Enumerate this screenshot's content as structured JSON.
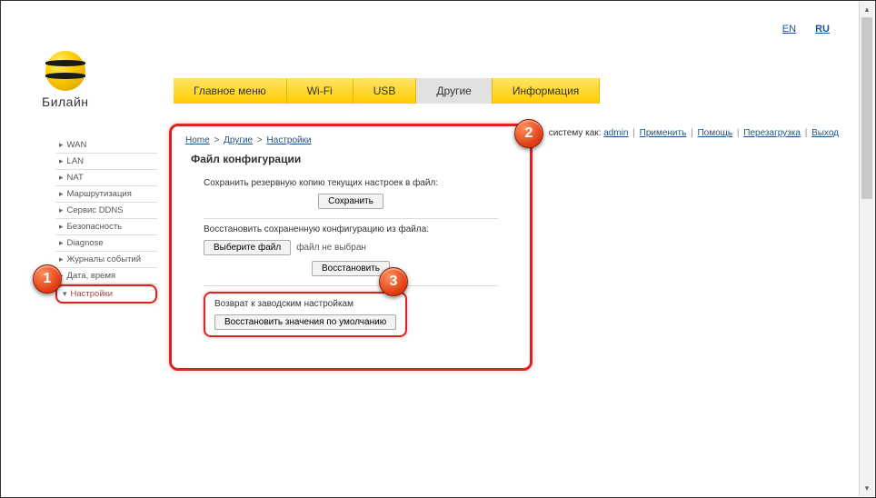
{
  "lang": {
    "en": "EN",
    "ru": "RU"
  },
  "logo_text": "Билайн",
  "nav": {
    "items": [
      {
        "label": "Главное меню"
      },
      {
        "label": "Wi-Fi"
      },
      {
        "label": "USB"
      },
      {
        "label": "Другие"
      },
      {
        "label": "Информация"
      }
    ]
  },
  "status": {
    "prefix": "систему как:",
    "user": "admin",
    "apply": "Применить",
    "help": "Помощь",
    "reboot": "Перезагрузка",
    "logout": "Выход"
  },
  "sidebar": {
    "items": [
      {
        "label": "WAN"
      },
      {
        "label": "LAN"
      },
      {
        "label": "NAT"
      },
      {
        "label": "Маршрутизация"
      },
      {
        "label": "Сервис DDNS"
      },
      {
        "label": "Безопасность"
      },
      {
        "label": "Diagnose"
      },
      {
        "label": "Журналы событий"
      },
      {
        "label": "Дата, время"
      },
      {
        "label": "Настройки"
      }
    ]
  },
  "breadcrumb": {
    "home": "Home",
    "other": "Другие",
    "settings": "Настройки"
  },
  "page_title": "Файл конфигурации",
  "sections": {
    "save": {
      "label": "Сохранить резервную копию текущих настроек в файл:",
      "button": "Сохранить"
    },
    "restore": {
      "label": "Восстановить сохраненную конфигурацию из файла:",
      "choose": "Выберите файл",
      "nofile": "файл не выбран",
      "button": "Восстановить"
    },
    "reset": {
      "label": "Возврат к заводским настройкам",
      "button": "Восстановить значения по умолчанию"
    }
  },
  "badges": {
    "b1": "1",
    "b2": "2",
    "b3": "3"
  }
}
